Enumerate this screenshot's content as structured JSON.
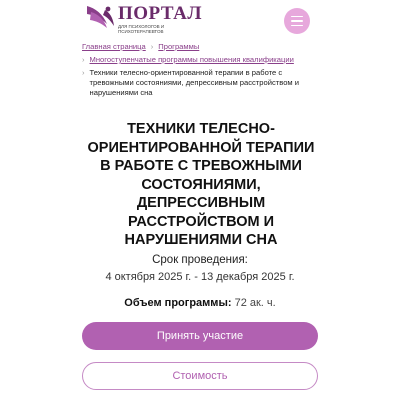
{
  "header": {
    "logo_title": "ПОРТАЛ",
    "logo_subtitle": "для психологов и психотерапевтов",
    "logo_icon": "wing-icon",
    "menu_icon": "hamburger-icon"
  },
  "breadcrumbs": {
    "items": [
      "Главная страница",
      "Программы",
      "Многоступенчатые программы повышения квалификации"
    ],
    "current": "Техники телесно-ориентированной терапии в работе с тревожными состояниями, депрессивным расстройством и нарушениями сна"
  },
  "title": "Техники телесно-ориентированной терапии в работе с тревожными состояниями, депрессивным расстройством и нарушениями сна",
  "period": {
    "label": "Срок проведения:",
    "value": "4 октября 2025 г. - 13 декабря 2025 г."
  },
  "volume": {
    "label": "Объем программы:",
    "value": "72 ак. ч."
  },
  "buttons": {
    "participate": "Принять участие",
    "cost": "Стоимость"
  },
  "colors": {
    "accent": "#b161b1",
    "brand": "#6a2b6a",
    "menu_bg": "#e7a8dc"
  }
}
